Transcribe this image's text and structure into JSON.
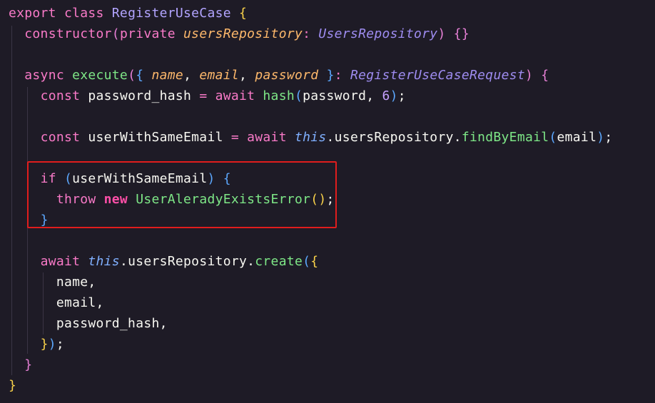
{
  "editor": {
    "background": "#1e1b26",
    "highlight_color": "#e01d1d",
    "tokens": {
      "l1_export": "export",
      "l1_class": "class",
      "l1_name": "RegisterUseCase",
      "l1_brace": "{",
      "l2_constructor": "constructor",
      "l2_paren_open": "(",
      "l2_private": "private",
      "l2_param": "usersRepository",
      "l2_colon": ":",
      "l2_type": "UsersRepository",
      "l2_paren_close": ")",
      "l2_body": "{}",
      "l4_async": "async",
      "l4_execute": "execute",
      "l4_paren_open": "(",
      "l4_brace_open": "{",
      "l4_name": "name",
      "l4_comma1": ",",
      "l4_email": "email",
      "l4_comma2": ",",
      "l4_password": "password",
      "l4_brace_close": "}",
      "l4_colon": ":",
      "l4_type": "RegisterUseCaseRequest",
      "l4_paren_close": ")",
      "l4_body_open": "{",
      "l5_const": "const",
      "l5_var": "password_hash",
      "l5_eq": "=",
      "l5_await": "await",
      "l5_fn": "hash",
      "l5_paren_open": "(",
      "l5_arg": "password,",
      "l5_num": "6",
      "l5_paren_close": ")",
      "l5_semi": ";",
      "l7_const": "const",
      "l7_var": "userWithSameEmail",
      "l7_eq": "=",
      "l7_await": "await",
      "l7_this": "this",
      "l7_prop": ".usersRepository.",
      "l7_fn": "findByEmail",
      "l7_paren_open": "(",
      "l7_arg": "email",
      "l7_paren_close": ")",
      "l7_semi": ";",
      "l9_if": "if",
      "l9_paren_open": "(",
      "l9_var": "userWithSameEmail",
      "l9_paren_close": ")",
      "l9_brace": "{",
      "l10_throw": "throw",
      "l10_new": "new",
      "l10_cls": "UserAleradyExistsError",
      "l10_parens": "()",
      "l10_semi": ";",
      "l11_brace": "}",
      "l13_await": "await",
      "l13_this": "this",
      "l13_prop": ".usersRepository.",
      "l13_fn": "create",
      "l13_paren_open": "(",
      "l13_brace_open": "{",
      "l14": "name,",
      "l15": "email,",
      "l16": "password_hash,",
      "l17_brace": "}",
      "l17_paren": ")",
      "l17_semi": ";",
      "l18_brace": "}",
      "l19_brace": "}"
    }
  }
}
